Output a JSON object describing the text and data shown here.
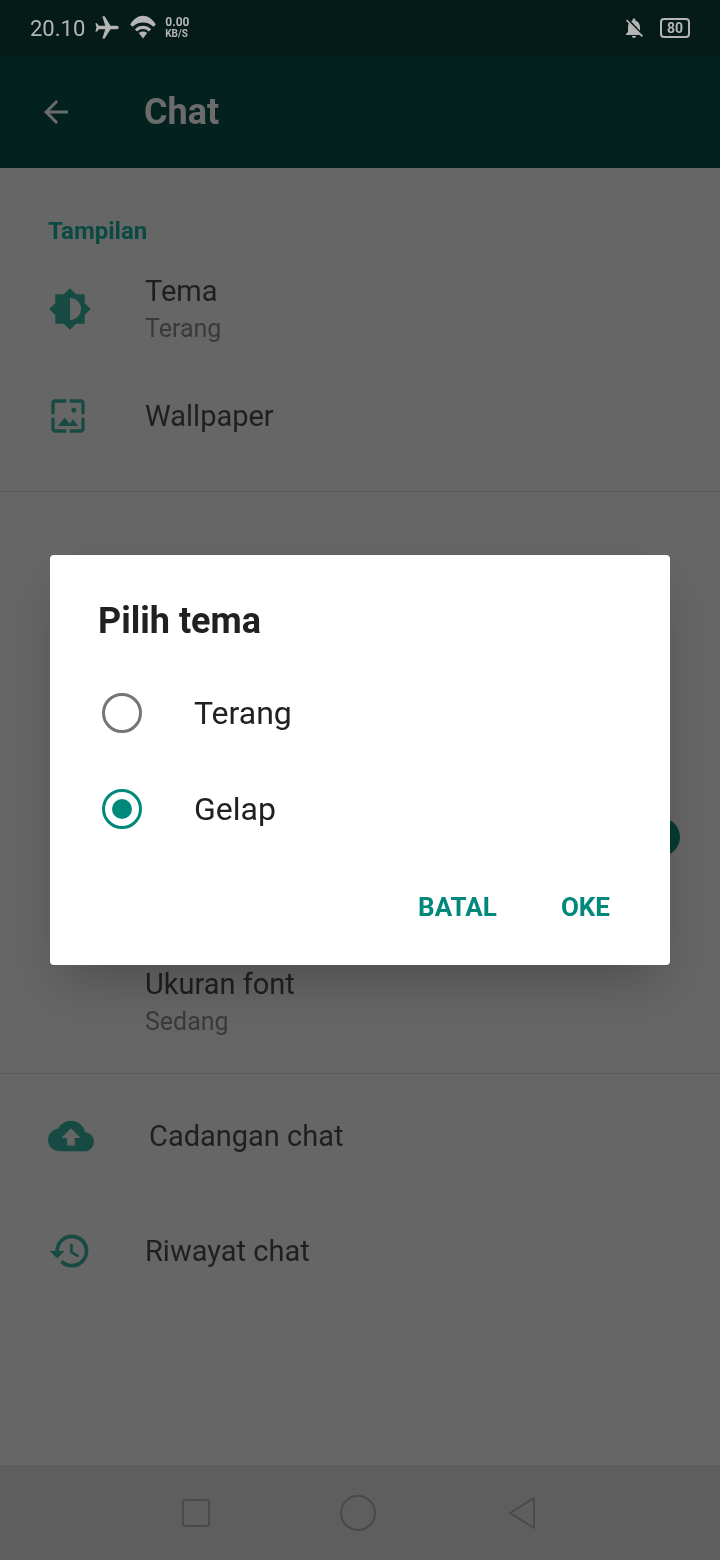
{
  "status_bar": {
    "time": "20.10",
    "speed_value": "0.00",
    "speed_unit": "KB/S",
    "battery": "80"
  },
  "app_bar": {
    "title": "Chat"
  },
  "section": {
    "title": "Tampilan"
  },
  "items_top": [
    {
      "kind": "theme",
      "title": "Tema",
      "subtitle": "Terang"
    },
    {
      "kind": "wallpaper",
      "title": "Wallpaper"
    }
  ],
  "font_item": {
    "title": "Ukuran font",
    "subtitle": "Sedang"
  },
  "items_bottom": [
    {
      "kind": "backup",
      "title": "Cadangan chat"
    },
    {
      "kind": "history",
      "title": "Riwayat chat"
    }
  ],
  "dialog": {
    "title": "Pilih tema",
    "options": [
      {
        "label": "Terang",
        "selected": false
      },
      {
        "label": "Gelap",
        "selected": true
      }
    ],
    "buttons": [
      "BATAL",
      "OKE"
    ]
  }
}
